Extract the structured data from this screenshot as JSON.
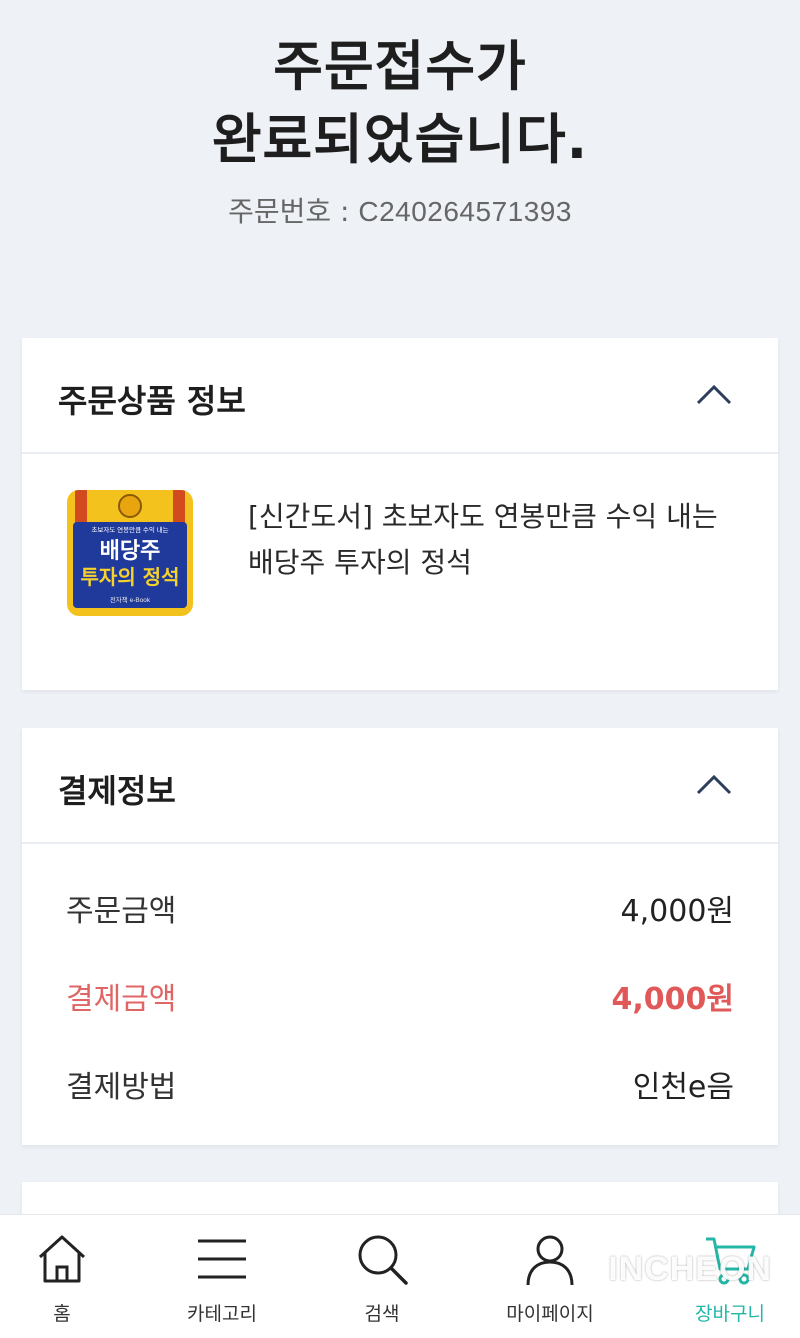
{
  "header": {
    "title_line1": "주문접수가",
    "title_line2": "완료되었습니다.",
    "order_label": "주문번호 : ",
    "order_number": "C240264571393"
  },
  "product_section": {
    "title": "주문상품 정보",
    "product_name": "[신간도서] 초보자도 연봉만큼 수익 내는 배당주 투자의 정석",
    "book_cover": {
      "top_text": "초보자도 연봉만큼 수익 내는",
      "title_line1": "배당주",
      "title_line2": "투자의 정석",
      "bottom_text": "전자책 e-Book"
    }
  },
  "payment_section": {
    "title": "결제정보",
    "rows": [
      {
        "label": "주문금액",
        "value": "4,000원"
      },
      {
        "label": "결제금액",
        "value": "4,000원"
      },
      {
        "label": "결제방법",
        "value": "인천e음"
      }
    ]
  },
  "bottom_nav": [
    {
      "label": "홈",
      "icon": "home-icon"
    },
    {
      "label": "카테고리",
      "icon": "menu-icon"
    },
    {
      "label": "검색",
      "icon": "search-icon"
    },
    {
      "label": "마이페이지",
      "icon": "user-icon"
    },
    {
      "label": "장바구니",
      "icon": "cart-icon",
      "active": true
    }
  ],
  "watermark": "INCHEON",
  "colors": {
    "accent_red": "#e05858",
    "accent_teal": "#24b6a7",
    "background": "#eef1f6"
  }
}
